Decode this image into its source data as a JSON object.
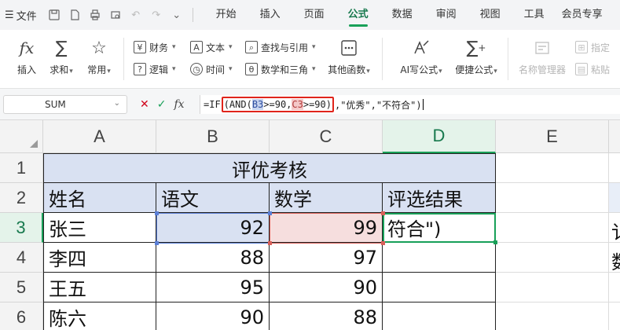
{
  "menubar": {
    "file_icon": "hamburger-icon",
    "file_label": "文件",
    "tabs": [
      {
        "label": "开始"
      },
      {
        "label": "插入"
      },
      {
        "label": "页面"
      },
      {
        "label": "公式",
        "active": true
      },
      {
        "label": "数据"
      },
      {
        "label": "审阅"
      },
      {
        "label": "视图"
      },
      {
        "label": "工具"
      },
      {
        "label": "会员专享"
      }
    ]
  },
  "ribbon": {
    "insert_label": "插入",
    "sum_label": "求和",
    "common_label": "常用",
    "finance_label": "财务",
    "logic_label": "逻辑",
    "text_label": "文本",
    "time_label": "时间",
    "lookup_label": "查找与引用",
    "math_label": "数学和三角",
    "other_label": "其他函数",
    "ai_label": "AI写公式",
    "quick_label": "便捷公式",
    "name_manager_label": "名称管理器",
    "define_label": "指定",
    "paste_label": "粘贴"
  },
  "formula_bar": {
    "name_box": "SUM",
    "formula_prefix": "=IF",
    "hl_open": "(AND(",
    "ref_b3": "B3",
    "hl_mid": ">=90,",
    "ref_c3": "C3",
    "hl_close": ">=90)",
    "formula_suffix": ",\"优秀\",\"不符合\")"
  },
  "grid": {
    "columns": [
      "A",
      "B",
      "C",
      "D",
      "E"
    ],
    "rows": [
      "1",
      "2",
      "3",
      "4",
      "5",
      "6"
    ],
    "title": "评优考核",
    "headers": [
      "姓名",
      "语文",
      "数学",
      "评选结果"
    ],
    "data": [
      {
        "name": "张三",
        "chinese": "92",
        "math": "99",
        "result": "符合\")"
      },
      {
        "name": "李四",
        "chinese": "88",
        "math": "97",
        "result": ""
      },
      {
        "name": "王五",
        "chinese": "95",
        "math": "90",
        "result": ""
      },
      {
        "name": "陈六",
        "chinese": "90",
        "math": "88",
        "result": ""
      }
    ],
    "overflow_chars": [
      "讠",
      "数"
    ]
  },
  "colors": {
    "accent": "#18a058",
    "header_fill": "#d9e1f2",
    "b3_ref": "#5b7fd6",
    "c3_ref": "#d9605a",
    "highlight_box": "#e0241b"
  }
}
